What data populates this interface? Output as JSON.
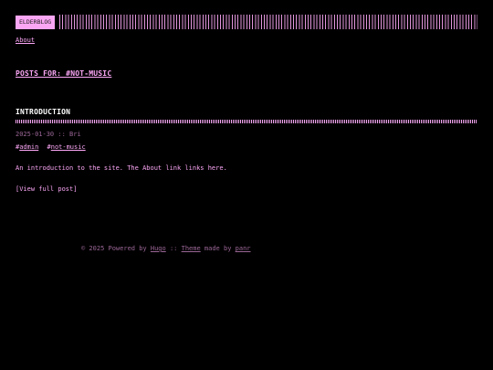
{
  "header": {
    "logo_text": "ELDERBLOG"
  },
  "menu": {
    "items": [
      {
        "label": "About"
      }
    ]
  },
  "page": {
    "heading": "POSTS FOR: #NOT-MUSIC"
  },
  "post": {
    "title": "INTRODUCTION",
    "date": "2025-01-30",
    "meta_separator": "::",
    "author": "Bri",
    "tags": [
      {
        "hash": "#",
        "name": "admin"
      },
      {
        "hash": "#",
        "name": "not-music"
      }
    ],
    "excerpt": "An introduction to the site. The About link links here.",
    "read_more": "[View full post]"
  },
  "footer": {
    "copyright": "© 2025 Powered by",
    "hugo_link": "Hugo",
    "separator": "::",
    "theme_link": "Theme",
    "made_by": "made by",
    "author_link": "panr"
  },
  "colors": {
    "background": "#000000",
    "accent": "#fba6f5",
    "muted": "#9a6696",
    "text": "#ffffff"
  }
}
